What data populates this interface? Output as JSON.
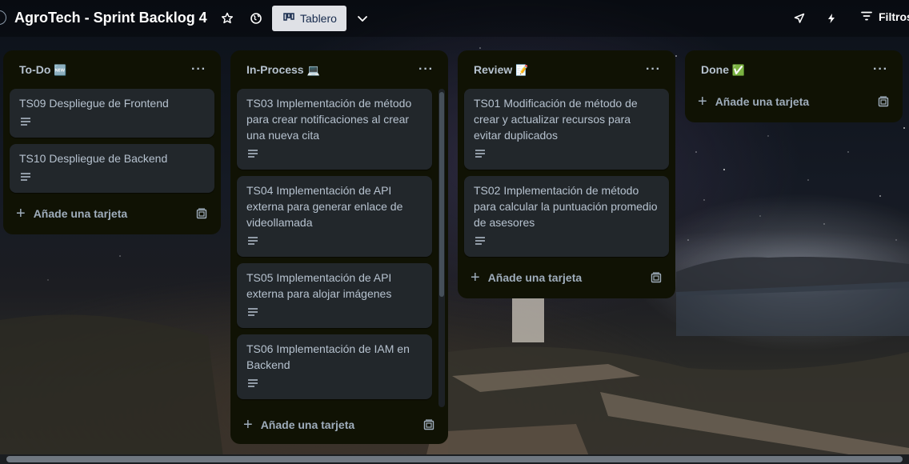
{
  "board": {
    "title": "AgroTech - Sprint Backlog 4",
    "view_label": "Tablero",
    "filters_label": "Filtros"
  },
  "colors": {
    "list_bg": "#101204",
    "card_bg": "#22272b",
    "text": "#b6c2cf",
    "view_btn_bg": "#dfe1e6"
  },
  "lists": [
    {
      "title": "To-Do",
      "title_icon": "🆕",
      "cards": [
        {
          "text": "TS09 Despliegue de Frontend"
        },
        {
          "text": "TS10 Despliegue de Backend"
        }
      ],
      "add_label": "Añade una tarjeta"
    },
    {
      "title": "In-Process",
      "title_icon": "💻",
      "cards": [
        {
          "text": "TS03 Implementación de método para crear notificaciones al crear una nueva cita"
        },
        {
          "text": "TS04 Implementación de API externa para generar enlace de videollamada"
        },
        {
          "text": "TS05 Implementación de API externa para alojar imágenes"
        },
        {
          "text": "TS06 Implementación de IAM en Backend"
        }
      ],
      "add_label": "Añade una tarjeta"
    },
    {
      "title": "Review",
      "title_icon": "📝",
      "cards": [
        {
          "text": "TS01 Modificación de método de crear y actualizar recursos para evitar duplicados"
        },
        {
          "text": "TS02 Implementación de método para calcular la puntuación promedio de asesores"
        }
      ],
      "add_label": "Añade una tarjeta"
    },
    {
      "title": "Done",
      "title_icon": "✅",
      "cards": [],
      "add_label": "Añade una tarjeta"
    }
  ],
  "icons": [
    "star-icon",
    "globe-icon",
    "board-view-icon",
    "chevron-down-icon",
    "rocket-icon",
    "lightning-icon",
    "filter-icon",
    "more-icon",
    "description-icon",
    "plus-icon",
    "template-icon"
  ]
}
